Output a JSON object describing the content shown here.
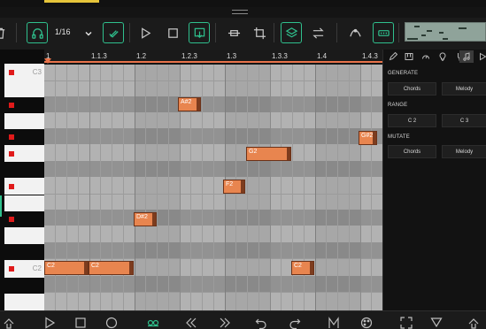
{
  "toolbar": {
    "quantize_value": "1/16",
    "accent_color": "#2fc08d"
  },
  "ruler": {
    "labels": [
      "1",
      "1.1.3",
      "1.2",
      "1.2.3",
      "1.3",
      "1.3.3",
      "1.4",
      "1.4.3"
    ]
  },
  "keyboard": {
    "labels": {
      "c3": "C3",
      "c2": "C2"
    }
  },
  "notes": [
    {
      "label": "A#2",
      "pitch": "A#2"
    },
    {
      "label": "G#2",
      "pitch": "G#2"
    },
    {
      "label": "G2",
      "pitch": "G2"
    },
    {
      "label": "F2",
      "pitch": "F2"
    },
    {
      "label": "D#2",
      "pitch": "D#2"
    },
    {
      "label": "C2",
      "pitch": "C2"
    },
    {
      "label": "C2",
      "pitch": "C2"
    },
    {
      "label": "C2",
      "pitch": "C2"
    }
  ],
  "panel": {
    "generate": {
      "title": "GENERATE",
      "chords": "Chords",
      "melody": "Melody"
    },
    "range": {
      "title": "RANGE",
      "low": "C 2",
      "high": "C 3"
    },
    "mutate": {
      "title": "MUTATE",
      "chords": "Chords",
      "melody": "Melody"
    }
  },
  "colors": {
    "note_fill": "#e8854f",
    "playhead": "#e8734a",
    "key_marker": "#e01a1a"
  }
}
